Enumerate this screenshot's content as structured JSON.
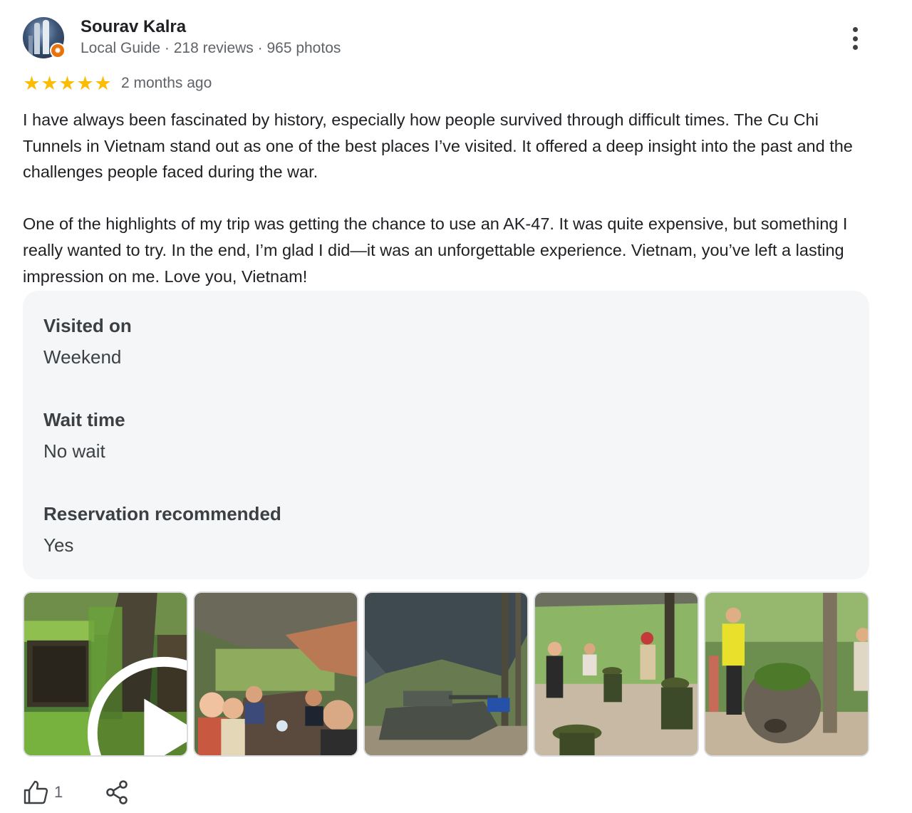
{
  "reviewer": {
    "name": "Sourav Kalra",
    "meta": "Local Guide · 218 reviews · 965 photos",
    "badge_icon": "local-guide-star-icon",
    "badge_color": "#e8710a"
  },
  "rating": {
    "stars": 5,
    "star_color": "#fbbc04",
    "date": "2 months ago"
  },
  "review": {
    "paragraphs": [
      "I have always been fascinated by history, especially how people survived through difficult times. The Cu Chi Tunnels in Vietnam stand out as one of the best places I’ve visited. It offered a deep insight into the past and the challenges people faced during the war.",
      "One of the highlights of my trip was getting the chance to use an AK-47. It was quite expensive, but something I really wanted to try. In the end, I’m glad I did—it was an unforgettable experience. Vietnam, you’ve left a lasting impression on me. Love you, Vietnam!"
    ]
  },
  "details": [
    {
      "label": "Visited on",
      "value": "Weekend"
    },
    {
      "label": "Wait time",
      "value": "No wait"
    },
    {
      "label": "Reservation recommended",
      "value": "Yes"
    }
  ],
  "photos": [
    {
      "name": "photo-tunnel-entrance-video",
      "is_video": true
    },
    {
      "name": "photo-group-dining",
      "is_video": false
    },
    {
      "name": "photo-tank-under-canopy",
      "is_video": false
    },
    {
      "name": "photo-visitors-in-forest",
      "is_video": false
    },
    {
      "name": "photo-termite-mound-guide",
      "is_video": false
    }
  ],
  "actions": {
    "like_icon": "thumbs-up-icon",
    "like_count": "1",
    "share_icon": "share-icon"
  }
}
